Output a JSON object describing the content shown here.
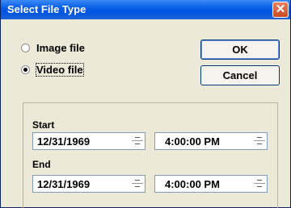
{
  "window": {
    "title": "Select File Type",
    "close_symbol": "✕"
  },
  "file_type": {
    "options": [
      {
        "label": "Image file",
        "checked": false
      },
      {
        "label": "Video file",
        "checked": true
      }
    ]
  },
  "buttons": {
    "ok_label": "OK",
    "cancel_label": "Cancel"
  },
  "start": {
    "label": "Start",
    "date": "12/31/1969",
    "time": "4:00:00 PM"
  },
  "end": {
    "label": "End",
    "date": "12/31/1969",
    "time": "4:00:00 PM"
  },
  "colors": {
    "titlebar": "#0054e3",
    "dialog_bg": "#ece9d8",
    "field_border": "#7f9db9"
  }
}
